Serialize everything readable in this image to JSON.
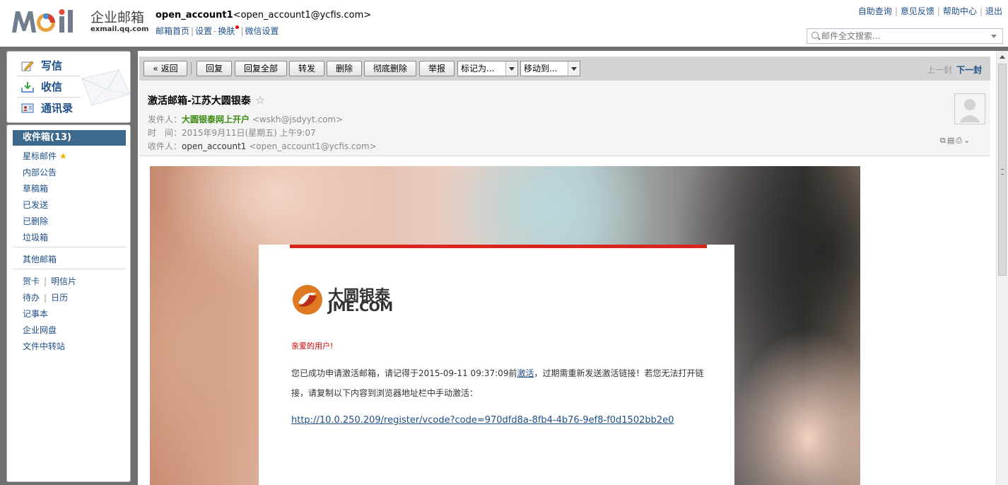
{
  "header": {
    "logo_text": "Moil",
    "logo_cn": "企业邮箱",
    "logo_domain": "exmail.qq.com",
    "account_name": "open_account1",
    "account_email": "<open_account1@ycfis.com>",
    "nav": [
      "邮箱首页",
      "设置",
      "换肤",
      "微信设置"
    ],
    "top_links": [
      "自助查询",
      "意见反馈",
      "帮助中心",
      "退出"
    ],
    "search_placeholder": "邮件全文搜索..."
  },
  "left": {
    "compose": "写信",
    "receive": "收信",
    "contacts": "通讯录",
    "inbox": "收件箱(13)",
    "folders": [
      "星标邮件",
      "内部公告",
      "草稿箱",
      "已发送",
      "已删除",
      "垃圾箱"
    ],
    "other": "其他邮箱",
    "card": "贺卡",
    "postcard": "明信片",
    "todo": "待办",
    "calendar": "日历",
    "notes": "记事本",
    "disk": "企业网盘",
    "transfer": "文件中转站"
  },
  "toolbar": {
    "back": "« 返回",
    "reply": "回复",
    "reply_all": "回复全部",
    "forward": "转发",
    "delete": "删除",
    "delete_perm": "彻底删除",
    "report": "举报",
    "mark_as": "标记为...",
    "move_to": "移动到...",
    "prev": "上一封",
    "next": "下一封"
  },
  "mail": {
    "subject": "激活邮箱-江苏大圆银泰",
    "from_label": "发件人：",
    "from_name": "大圆银泰网上开户",
    "from_email": "<wskh@jsdyyt.com>",
    "time_label": "时　间：",
    "time": "2015年9月11日(星期五) 上午9:07",
    "to_label": "收件人：",
    "to_name": "open_account1",
    "to_email": "<open_account1@ycfis.com>"
  },
  "body": {
    "logo_cn": "大圆银泰",
    "logo_en": "JME.COM",
    "greeting": "亲爱的用户!",
    "para_before": "您已成功申请激活邮箱，请记得于2015-09-11 09:37:09前",
    "para_link": "激活",
    "para_after": "，过期需重新发送激活链接！若您无法打开链接，请复制以下内容到浏览器地址栏中手动激活：",
    "url": "http://10.0.250.209/register/vcode?code=970dfd8a-8fb4-4b76-9ef8-f0d1502bb2e0"
  }
}
